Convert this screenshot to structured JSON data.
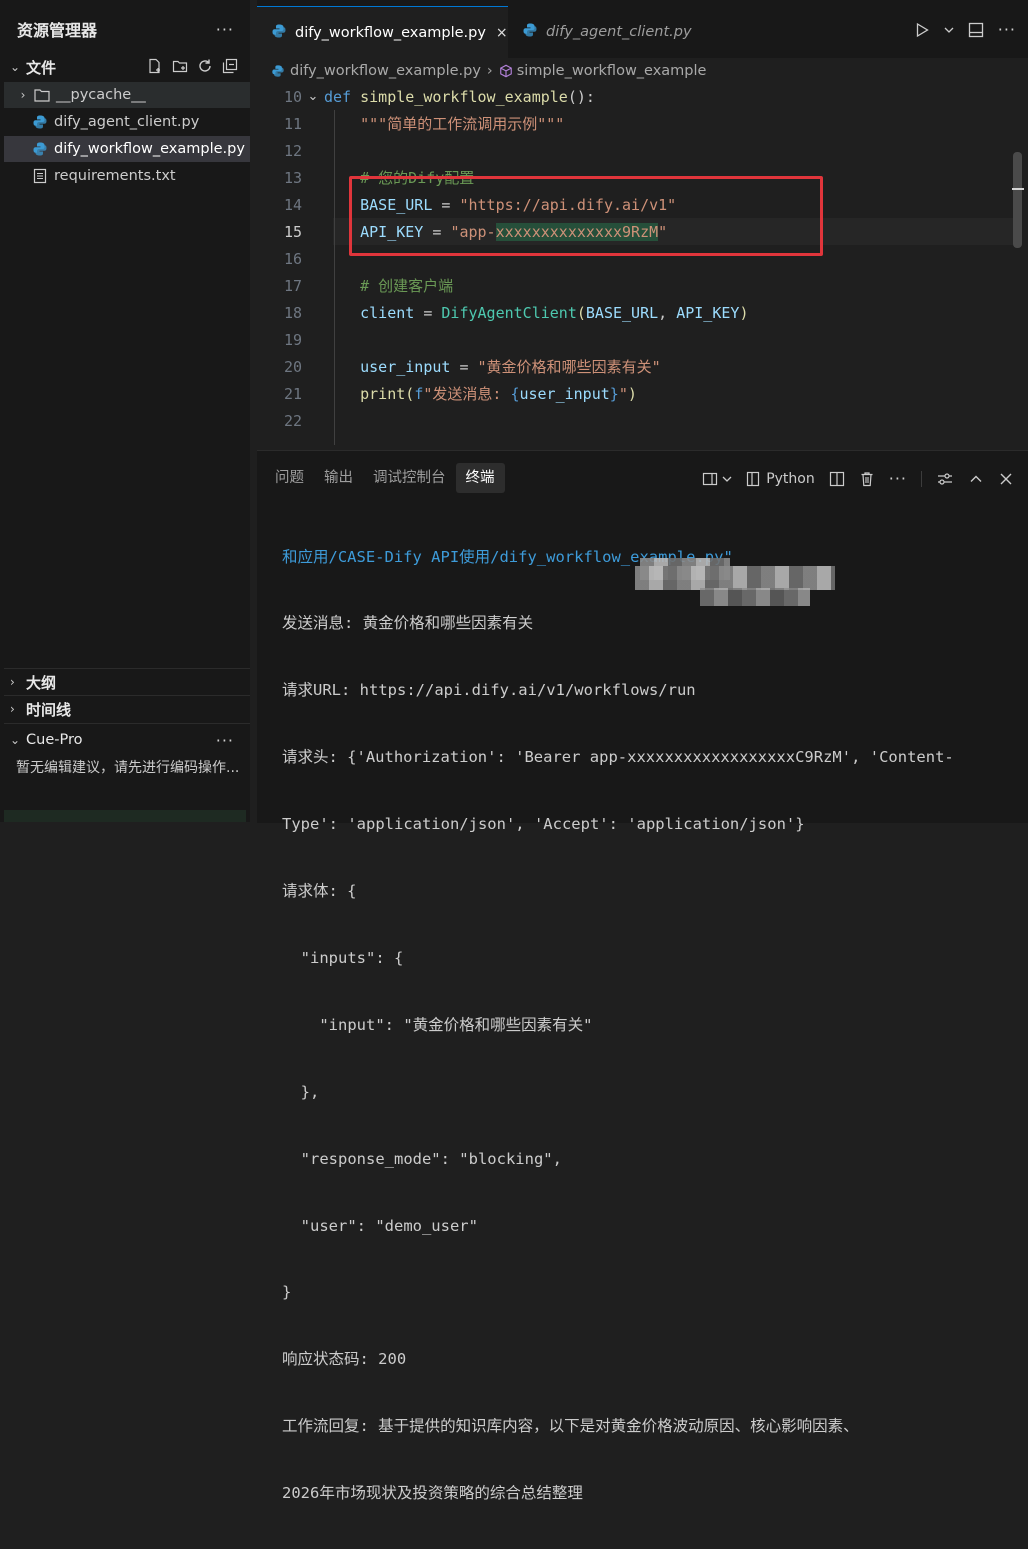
{
  "sidebar": {
    "title": "资源管理器",
    "more": "···",
    "files_section": "文件",
    "files": [
      {
        "name": "__pycache__",
        "type": "folder"
      },
      {
        "name": "dify_agent_client.py",
        "type": "python"
      },
      {
        "name": "dify_workflow_example.py",
        "type": "python",
        "selected": true
      },
      {
        "name": "requirements.txt",
        "type": "text"
      }
    ],
    "outline": "大纲",
    "timeline": "时间线",
    "cue_title": "Cue-Pro",
    "cue_more": "···",
    "cue_message": "暂无编辑建议，请先进行编码操作..."
  },
  "tabs": [
    {
      "label": "dify_workflow_example.py",
      "active": true
    },
    {
      "label": "dify_agent_client.py",
      "active": false
    }
  ],
  "tab_close": "×",
  "breadcrumb": {
    "file": "dify_workflow_example.py",
    "symbol": "simple_workflow_example"
  },
  "code": {
    "line_numbers": [
      "10",
      "11",
      "12",
      "13",
      "14",
      "15",
      "16",
      "17",
      "18",
      "19",
      "20",
      "21",
      "22"
    ],
    "current_line": "15",
    "l10_kw": "def",
    "l10_fn": "simple_workflow_example",
    "l10_rest": "():",
    "l11_doc": "\"\"\"简单的工作流调用示例\"\"\"",
    "l13_cmt": "# 您的Dify配置",
    "l14_var": "BASE_URL",
    "l14_eq": " = ",
    "l14_str": "\"https://api.dify.ai/v1\"",
    "l15_var": "API_KEY",
    "l15_eq": " = ",
    "l15_str_a": "\"app-",
    "l15_str_b": "xxxxxxxxxxxxxx9RzM",
    "l15_str_c": "\"",
    "l17_cmt": "# 创建客户端",
    "l18_var": "client",
    "l18_eq": " = ",
    "l18_cls": "DifyAgentClient",
    "l18_p1": "(",
    "l18_a1": "BASE_URL",
    "l18_c": ", ",
    "l18_a2": "API_KEY",
    "l18_p2": ")",
    "l20_var": "user_input",
    "l20_eq": " = ",
    "l20_str": "\"黄金价格和哪些因素有关\"",
    "l21_fn": "print",
    "l21_p1": "(",
    "l21_f": "f",
    "l21_str1": "\"发送消息: ",
    "l21_br1": "{",
    "l21_var": "user_input",
    "l21_br2": "}",
    "l21_str2": "\"",
    "l21_p2": ")"
  },
  "panel": {
    "tabs": [
      "问题",
      "输出",
      "调试控制台",
      "终端"
    ],
    "active_tab": "终端",
    "shell_label": "Python",
    "terminal_lines": [
      {
        "text": "和应用/CASE-Dify API使用/dify_workflow_example.py\"",
        "kind": "path"
      },
      {
        "text": "发送消息: 黄金价格和哪些因素有关",
        "kind": "out"
      },
      {
        "text": "请求URL: https://api.dify.ai/v1/workflows/run",
        "kind": "out"
      },
      {
        "text": "请求头: {'Authorization': 'Bearer app-xxxxxxxxxxxxxxxxxxC9RzM', 'Content-",
        "kind": "out"
      },
      {
        "text": "Type': 'application/json', 'Accept': 'application/json'}",
        "kind": "out"
      },
      {
        "text": "请求体: {",
        "kind": "out"
      },
      {
        "text": "  \"inputs\": {",
        "kind": "out"
      },
      {
        "text": "    \"input\": \"黄金价格和哪些因素有关\"",
        "kind": "out"
      },
      {
        "text": "  },",
        "kind": "out"
      },
      {
        "text": "  \"response_mode\": \"blocking\",",
        "kind": "out"
      },
      {
        "text": "  \"user\": \"demo_user\"",
        "kind": "out"
      },
      {
        "text": "}",
        "kind": "out"
      },
      {
        "text": "响应状态码: 200",
        "kind": "out"
      },
      {
        "text": "工作流回复: 基于提供的知识库内容，以下是对黄金价格波动原因、核心影响因素、",
        "kind": "out"
      },
      {
        "text": "2026年市场现状及投资策略的综合总结整理",
        "kind": "out"
      }
    ]
  },
  "colors": {
    "accent": "#0078d4",
    "highlight_box": "#e0353b"
  }
}
